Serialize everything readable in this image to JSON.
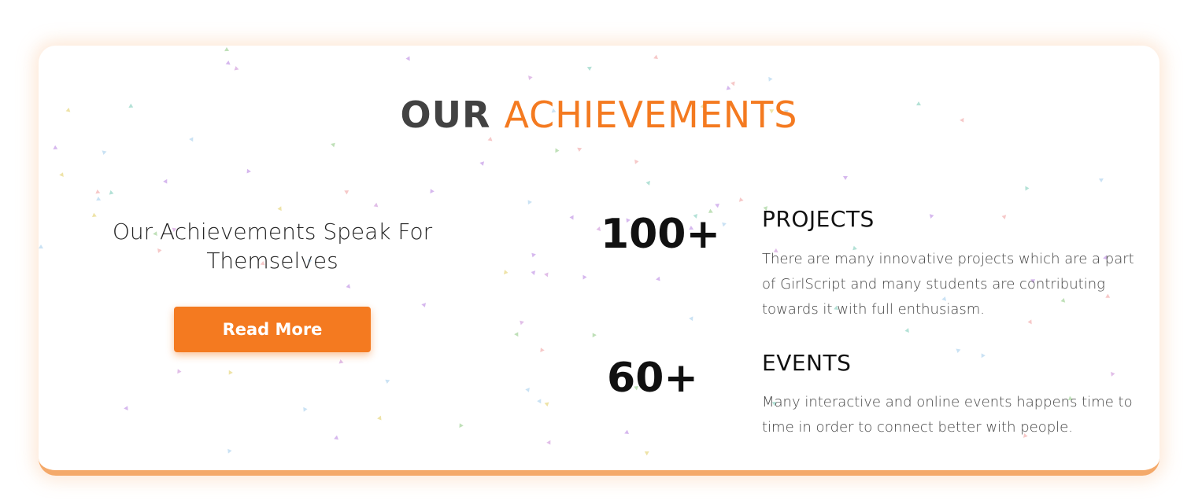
{
  "heading": {
    "part1": "OUR",
    "part2": "ACHIEVEMENTS"
  },
  "left": {
    "tagline": "Our Achievements Speak For Themselves",
    "button_label": "Read More"
  },
  "stats": [
    {
      "number": "100+",
      "title": "PROJECTS",
      "description": "There are many innovative projects which are a part of GirlScript and many students are contributing towards it with full enthusiasm."
    },
    {
      "number": "60+",
      "title": "EVENTS",
      "description": "Many interactive and online events happens time to time in order to connect better with people."
    }
  ],
  "colors": {
    "accent": "#f47a20",
    "heading_dark": "#424242",
    "card_border": "#f4a96a"
  }
}
